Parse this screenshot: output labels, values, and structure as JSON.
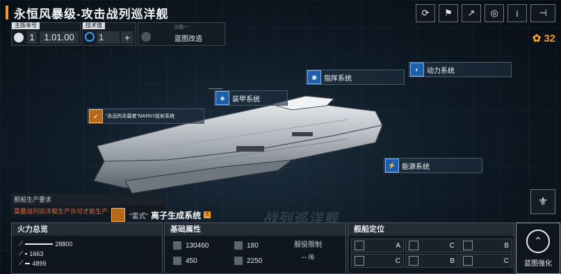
{
  "title": "永恒风暴级-攻击战列巡洋舰",
  "version": {
    "label": "主版本号",
    "major": "1",
    "minor": "1.01.00"
  },
  "tech": {
    "label": "技术值",
    "value": "1",
    "plus": "+"
  },
  "modify": {
    "label": "功能一",
    "text": "蓝图改造"
  },
  "top_buttons": [
    "⟳",
    "⚑",
    "↗",
    "◎",
    "i",
    "⊣"
  ],
  "currency": {
    "icon": "✿",
    "value": "32"
  },
  "systems": {
    "command": "指挥系统",
    "power": "动力系统",
    "armor": "装甲系统",
    "launcher": "\"永远的兆载者\"MARK!!投射系统",
    "energy": "能源系统",
    "generator_a": "\"雷式\"",
    "generator_b": "离子生成系统",
    "generator_badge": "5"
  },
  "production": {
    "header": "舰船生产要求",
    "warning": "需要战列巡洋舰生产许可才能生产"
  },
  "fire": {
    "title": "火力总览",
    "values": [
      "28800",
      "1663",
      "4899"
    ]
  },
  "base": {
    "title": "基础属性",
    "hp": "130460",
    "armor": "180",
    "speed": "450",
    "warp": "2250",
    "service_label": "服役限制",
    "service_value": "-- /6"
  },
  "position": {
    "title": "舰船定位",
    "grades": [
      "A",
      "C",
      "B",
      "C",
      "B",
      "C"
    ]
  },
  "strengthen": {
    "label": "蓝图强化",
    "icon": "⌃"
  },
  "watermark": "战列巡洋舰"
}
